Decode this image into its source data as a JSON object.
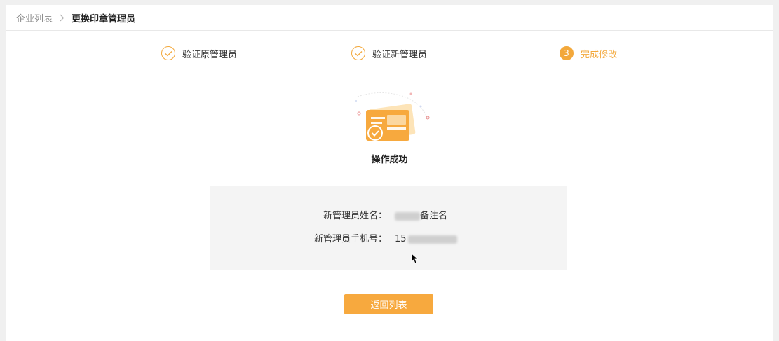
{
  "breadcrumb": {
    "parent": "企业列表",
    "current": "更换印章管理员",
    "separator_icon": "chevron-right-icon"
  },
  "steps": [
    {
      "label": "验证原管理员",
      "status": "done",
      "icon": "check-icon"
    },
    {
      "label": "验证新管理员",
      "status": "done",
      "icon": "check-icon"
    },
    {
      "label": "完成修改",
      "status": "active",
      "number": "3"
    }
  ],
  "result": {
    "icon": "success-card-icon",
    "message": "操作成功"
  },
  "info": {
    "name_label": "新管理员姓名：",
    "name_value": "备注名",
    "phone_label": "新管理员手机号：",
    "phone_value": "15"
  },
  "actions": {
    "back_label": "返回列表"
  },
  "colors": {
    "accent": "#f3a83b",
    "button": "#f7a93e",
    "info_bg": "#f4f4f4"
  }
}
